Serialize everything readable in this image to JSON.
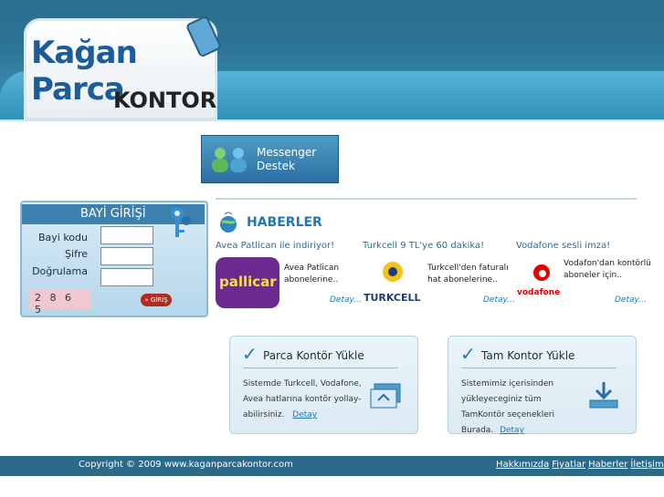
{
  "logo": {
    "word1": "Kağan Parca",
    "word2": "KONTOR"
  },
  "messenger": {
    "line1": "Messenger",
    "line2": "Destek"
  },
  "login": {
    "title": "BAYİ GİRİŞİ",
    "fields": [
      {
        "label": "Bayi kodu",
        "value": ""
      },
      {
        "label": "Şifre",
        "value": ""
      },
      {
        "label": "Doğrulama",
        "value": ""
      }
    ],
    "captcha": "2 8 6 5",
    "submit_label": "» GİRİŞ"
  },
  "news": {
    "heading": "HABERLER",
    "items": [
      {
        "title": "Avea Patlican ile indiriyor!",
        "body": "Avea Patlican abonelerine..",
        "more": "Detay...",
        "brand": "pallicar"
      },
      {
        "title": "Turkcell 9 TL'ye 60 dakika!",
        "body": "Turkcell'den faturalı hat abonelerine..",
        "more": "Detay...",
        "brand": "TURKCELL"
      },
      {
        "title": "Vodafone sesli imza!",
        "body": "Vodafon'dan kontörlü aboneler için..",
        "more": "Detay...",
        "brand": "vodafone"
      }
    ]
  },
  "cards": [
    {
      "title": "Parca Kontör Yükle",
      "body": "Sistemde Turkcell, Vodafone, Avea hatlarına kontör yollay-abilirsiniz.",
      "link": "Detay"
    },
    {
      "title": "Tam Kontor Yükle",
      "body": "Sistemimiz içerisinden yükleyeceginiz tüm TamKontör seçenekleri Burada.",
      "link": "Detay"
    }
  ],
  "footer": {
    "copyright": "Copyright © 2009 www.kaganparcakontor.com",
    "links": [
      "Hakkımızda",
      "Fiyatlar",
      "Haberler",
      "İletişim"
    ]
  },
  "colors": {
    "brand_blue": "#2277b5",
    "header_teal": "#2c7394",
    "footer": "#2b6a88"
  }
}
